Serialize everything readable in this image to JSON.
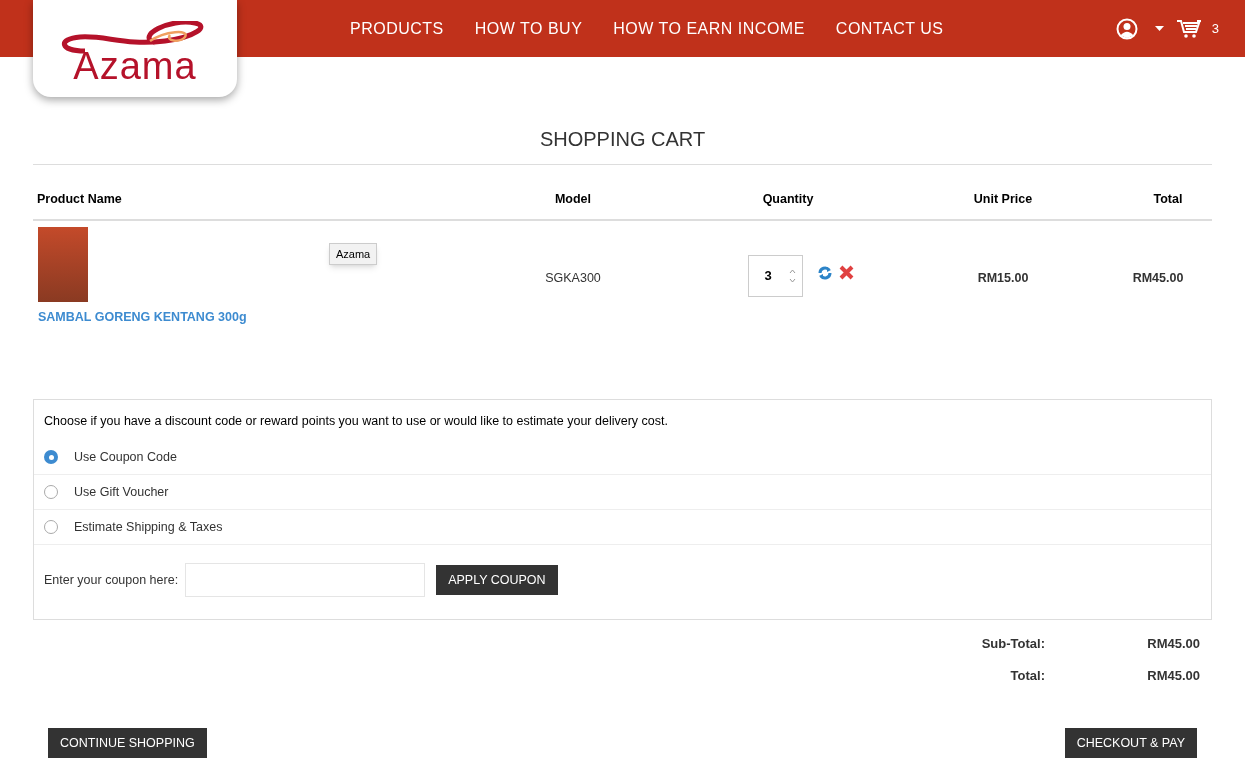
{
  "header": {
    "logo": "Azama",
    "nav": [
      "PRODUCTS",
      "HOW TO BUY",
      "HOW TO EARN INCOME",
      "CONTACT US"
    ],
    "cart_count": "3"
  },
  "title": "SHOPPING CART",
  "table": {
    "columns": [
      "Product Name",
      "Model",
      "Quantity",
      "Unit Price",
      "Total"
    ],
    "rows": [
      {
        "product": "SAMBAL GORENG KENTANG 300g",
        "tooltip": "Azama",
        "model": "SGKA300",
        "quantity": "3",
        "unit_price": "RM15.00",
        "total": "RM45.00"
      }
    ]
  },
  "options": {
    "intro": "Choose if you have a discount code or reward points you want to use or would like to estimate your delivery cost.",
    "radios": [
      {
        "label": "Use Coupon Code",
        "selected": true
      },
      {
        "label": "Use Gift Voucher",
        "selected": false
      },
      {
        "label": "Estimate Shipping & Taxes",
        "selected": false
      }
    ],
    "coupon_label": "Enter your coupon here:",
    "apply_button": "APPLY COUPON"
  },
  "totals": [
    {
      "label": "Sub-Total:",
      "value": "RM45.00"
    },
    {
      "label": "Total:",
      "value": "RM45.00"
    }
  ],
  "buttons": {
    "continue": "CONTINUE SHOPPING",
    "checkout": "CHECKOUT & PAY"
  }
}
